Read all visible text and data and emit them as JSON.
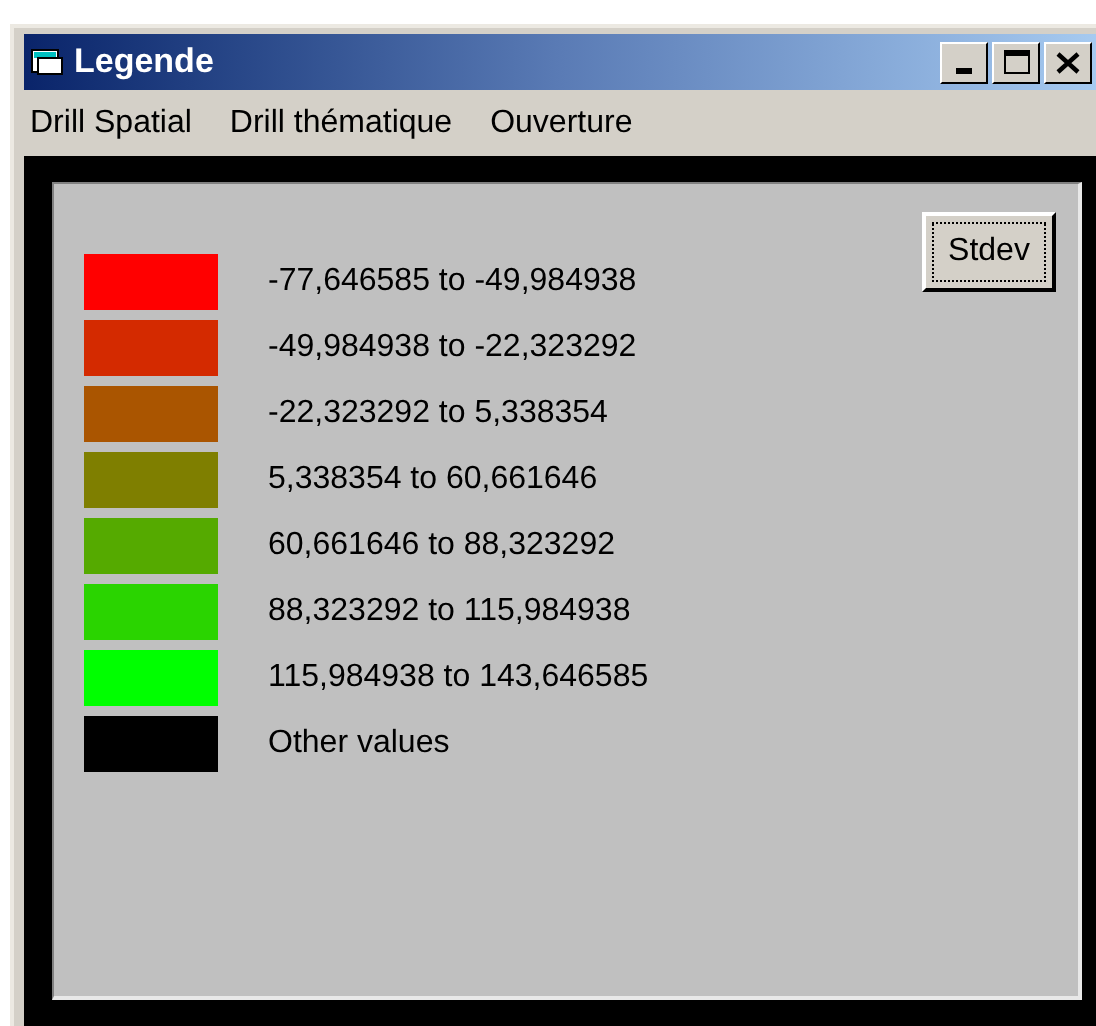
{
  "window": {
    "title": "Legende"
  },
  "menu": [
    {
      "label": "Drill Spatial"
    },
    {
      "label": "Drill thématique"
    },
    {
      "label": "Ouverture"
    }
  ],
  "legend": [
    {
      "label": "-77,646585 to -49,984938",
      "color": "#ff0000"
    },
    {
      "label": "-49,984938 to -22,323292",
      "color": "#d42a00"
    },
    {
      "label": "-22,323292 to 5,338354",
      "color": "#aa5500"
    },
    {
      "label": "5,338354 to 60,661646",
      "color": "#7f7f00"
    },
    {
      "label": "60,661646 to 88,323292",
      "color": "#55aa00"
    },
    {
      "label": "88,323292 to 115,984938",
      "color": "#2ad400"
    },
    {
      "label": "115,984938 to 143,646585",
      "color": "#00ff00"
    },
    {
      "label": "Other values",
      "color": "#000000"
    }
  ],
  "button": {
    "label": "Stdev"
  }
}
